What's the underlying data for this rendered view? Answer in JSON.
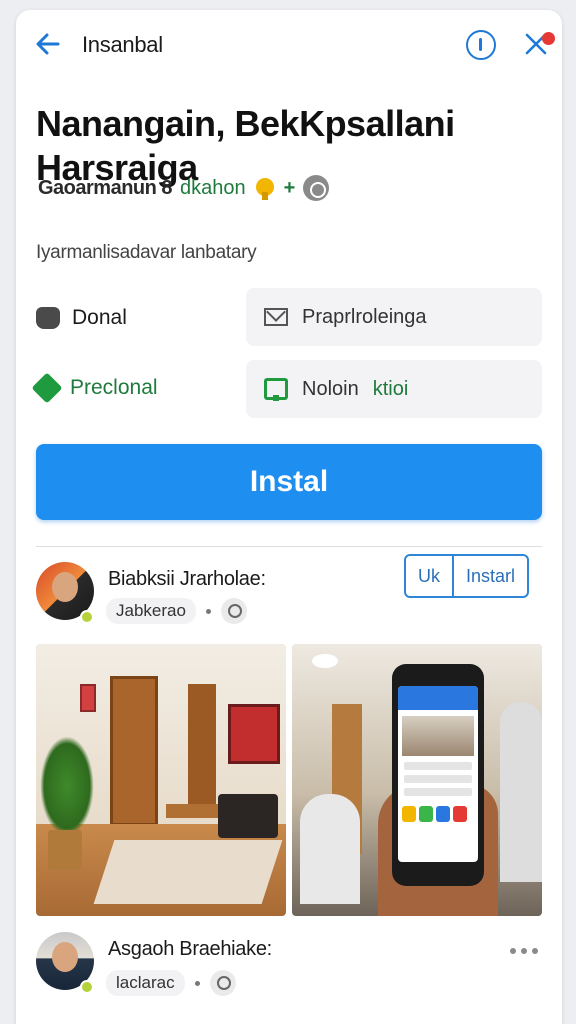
{
  "header": {
    "title": "Insanbal",
    "back_icon": "arrow-left-icon",
    "info_icon": "info-icon",
    "close_icon": "close-icon",
    "accent": "#1e78d6"
  },
  "app": {
    "title": "Nanangain, BekKpsallani Harsraiga",
    "subtitle_left": "Gaoarmanun 8",
    "subtitle_right": "dkahon",
    "subtitle_plus": "+",
    "description": "Iyarmanlisadavar lanbatary",
    "meta_left": [
      {
        "label": "Donal",
        "icon": "apple-icon"
      },
      {
        "label": "Preclonal",
        "icon": "tag-icon"
      }
    ],
    "meta_right": [
      {
        "label": "Praprlroleinga",
        "icon": "mail-icon"
      },
      {
        "label_a": "Noloin",
        "label_b": "ktioi",
        "icon": "folder-icon"
      }
    ]
  },
  "install": {
    "label": "Instal",
    "color": "#1e8ef0"
  },
  "reviews": [
    {
      "name": "Biabksii Jrarholae:",
      "chip": "Jabkerao",
      "buttons": [
        "Uk",
        "Instarl"
      ]
    },
    {
      "name": "Asgaoh Braehiake:",
      "chip": "laclarac"
    }
  ]
}
